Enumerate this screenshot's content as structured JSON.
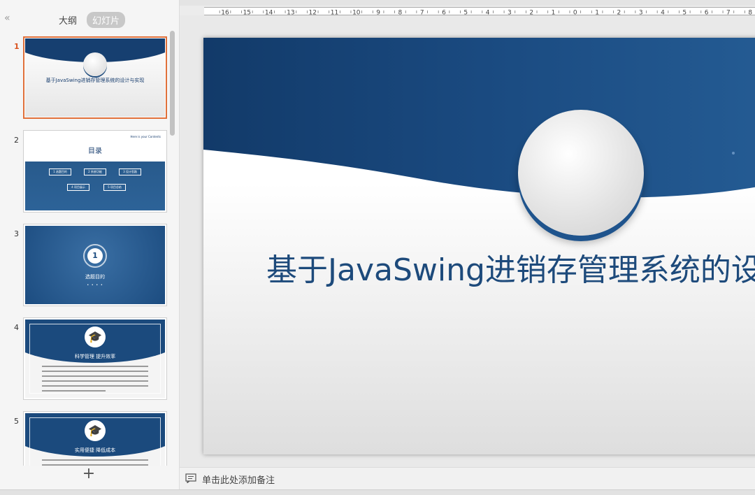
{
  "left_pane": {
    "collapse_icon": "«",
    "tabs": [
      {
        "label": "大纲",
        "active": false
      },
      {
        "label": "幻灯片",
        "active": true
      }
    ],
    "add_icon": "+"
  },
  "thumbnails": [
    {
      "number": "1",
      "selected": true,
      "kind": "cover",
      "title": "基于JavaSwing进销存管理系统的设计与实现"
    },
    {
      "number": "2",
      "selected": false,
      "kind": "toc",
      "title": "目录",
      "subtitle": "Here is your Contents",
      "items": [
        "1 选题目的",
        "2 系统功能",
        "3 设计思路",
        "4 项目展示",
        "5 项目总结"
      ]
    },
    {
      "number": "3",
      "selected": false,
      "kind": "section",
      "index": "1",
      "title": "选题目的",
      "dots": "• • • •"
    },
    {
      "number": "4",
      "selected": false,
      "kind": "content",
      "title": "科学管理 提升效率"
    },
    {
      "number": "5",
      "selected": false,
      "kind": "content",
      "title": "实用便捷 降低成本"
    }
  ],
  "slide": {
    "title": "基于JavaSwing进销存管理系统的设计与实现"
  },
  "notes": {
    "placeholder": "单击此处添加备注"
  },
  "ruler": {
    "labels": [
      "16",
      "15",
      "14",
      "13",
      "12",
      "11",
      "10",
      "9",
      "8",
      "7",
      "6",
      "5",
      "4",
      "3",
      "2",
      "1",
      "0",
      "1",
      "2",
      "3",
      "4",
      "5",
      "6",
      "7",
      "8"
    ]
  },
  "colors": {
    "accent_selected": "#e0703a",
    "slide_blue": "#163f70",
    "title_blue": "#1d4a7b"
  }
}
